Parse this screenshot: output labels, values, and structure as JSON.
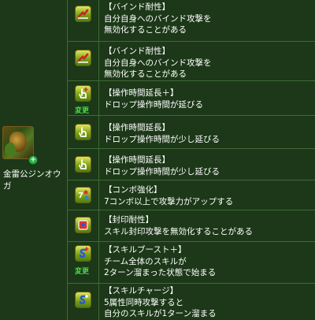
{
  "character": {
    "name": "金雷公ジンオウガ",
    "badge": "+"
  },
  "skills": [
    {
      "icon": "bind-resist-icon",
      "change": "",
      "title": "【バインド耐性】",
      "lines": [
        "自分自身へのバインド攻撃を",
        "無効化することがある"
      ]
    },
    {
      "icon": "bind-resist-icon",
      "change": "",
      "title": "【バインド耐性】",
      "lines": [
        "自分自身へのバインド攻撃を",
        "無効化することがある"
      ]
    },
    {
      "icon": "time-extend-plus-icon",
      "change": "変更",
      "title": "【操作時間延長＋】",
      "lines": [
        "ドロップ操作時間が延びる"
      ]
    },
    {
      "icon": "time-extend-icon",
      "change": "",
      "title": "【操作時間延長】",
      "lines": [
        "ドロップ操作時間が少し延びる"
      ]
    },
    {
      "icon": "time-extend-icon",
      "change": "",
      "title": "【操作時間延長】",
      "lines": [
        "ドロップ操作時間が少し延びる"
      ]
    },
    {
      "icon": "combo-enhance-icon",
      "change": "",
      "title": "【コンボ強化】",
      "lines": [
        "7コンボ以上で攻撃力がアップする"
      ]
    },
    {
      "icon": "seal-resist-icon",
      "change": "",
      "title": "【封印耐性】",
      "lines": [
        "スキル封印攻撃を無効化することがある"
      ]
    },
    {
      "icon": "skill-boost-plus-icon",
      "change": "変更",
      "title": "【スキルブースト＋】",
      "lines": [
        "チーム全体のスキルが",
        "2ターン溜まった状態で始まる"
      ]
    },
    {
      "icon": "skill-charge-icon",
      "change": "",
      "title": "【スキルチャージ】",
      "lines": [
        "5属性同時攻撃すると",
        "自分のスキルが1ターン溜まる"
      ]
    }
  ],
  "colors": {
    "background": "#1c3818",
    "border": "#3e6a35",
    "change_label": "#49d84a",
    "awakening_yellow": "#dfe660",
    "awakening_green": "#4f7d12"
  }
}
